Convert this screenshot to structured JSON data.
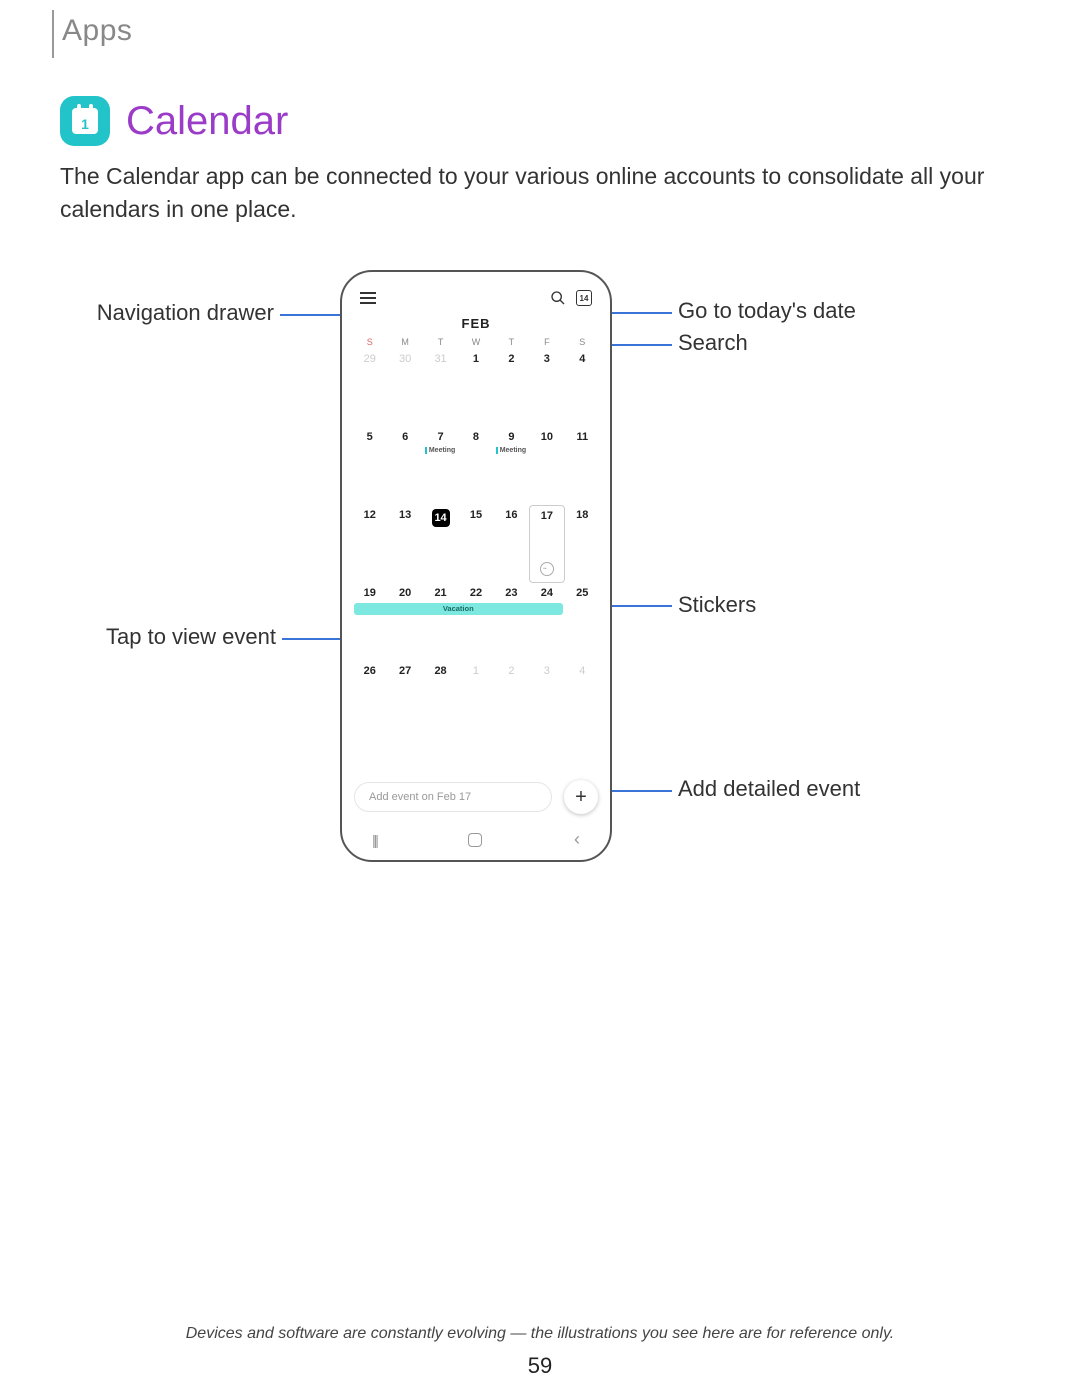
{
  "breadcrumb": "Apps",
  "app_icon_number": "1",
  "title": "Calendar",
  "intro": "The Calendar app can be connected to your various online accounts to consolidate all your calendars in one place.",
  "callouts": {
    "nav_drawer": "Navigation drawer",
    "today": "Go to today's date",
    "search": "Search",
    "stickers": "Stickers",
    "tap_event": "Tap to view event",
    "add_event": "Add detailed event"
  },
  "phone": {
    "month": "FEB",
    "today_icon": "14",
    "weekdays": [
      "S",
      "M",
      "T",
      "W",
      "T",
      "F",
      "S"
    ],
    "weeks": [
      [
        {
          "d": "29",
          "dim": true
        },
        {
          "d": "30",
          "dim": true
        },
        {
          "d": "31",
          "dim": true
        },
        {
          "d": "1"
        },
        {
          "d": "2"
        },
        {
          "d": "3"
        },
        {
          "d": "4"
        }
      ],
      [
        {
          "d": "5"
        },
        {
          "d": "6"
        },
        {
          "d": "7",
          "evt": "Meeting"
        },
        {
          "d": "8"
        },
        {
          "d": "9",
          "evt": "Meeting"
        },
        {
          "d": "10"
        },
        {
          "d": "11"
        }
      ],
      [
        {
          "d": "12"
        },
        {
          "d": "13"
        },
        {
          "d": "14",
          "today": true
        },
        {
          "d": "15"
        },
        {
          "d": "16"
        },
        {
          "d": "17",
          "selected": true,
          "sticker": true
        },
        {
          "d": "18"
        }
      ],
      [
        {
          "d": "19",
          "vacation": "Vacation"
        },
        {
          "d": "20"
        },
        {
          "d": "21"
        },
        {
          "d": "22"
        },
        {
          "d": "23"
        },
        {
          "d": "24"
        },
        {
          "d": "25"
        }
      ],
      [
        {
          "d": "26"
        },
        {
          "d": "27"
        },
        {
          "d": "28"
        },
        {
          "d": "1",
          "dim": true
        },
        {
          "d": "2",
          "dim": true
        },
        {
          "d": "3",
          "dim": true
        },
        {
          "d": "4",
          "dim": true
        }
      ]
    ],
    "add_event_placeholder": "Add event on Feb 17"
  },
  "footnote": "Devices and software are constantly evolving — the illustrations you see here are for reference only.",
  "page_number": "59"
}
